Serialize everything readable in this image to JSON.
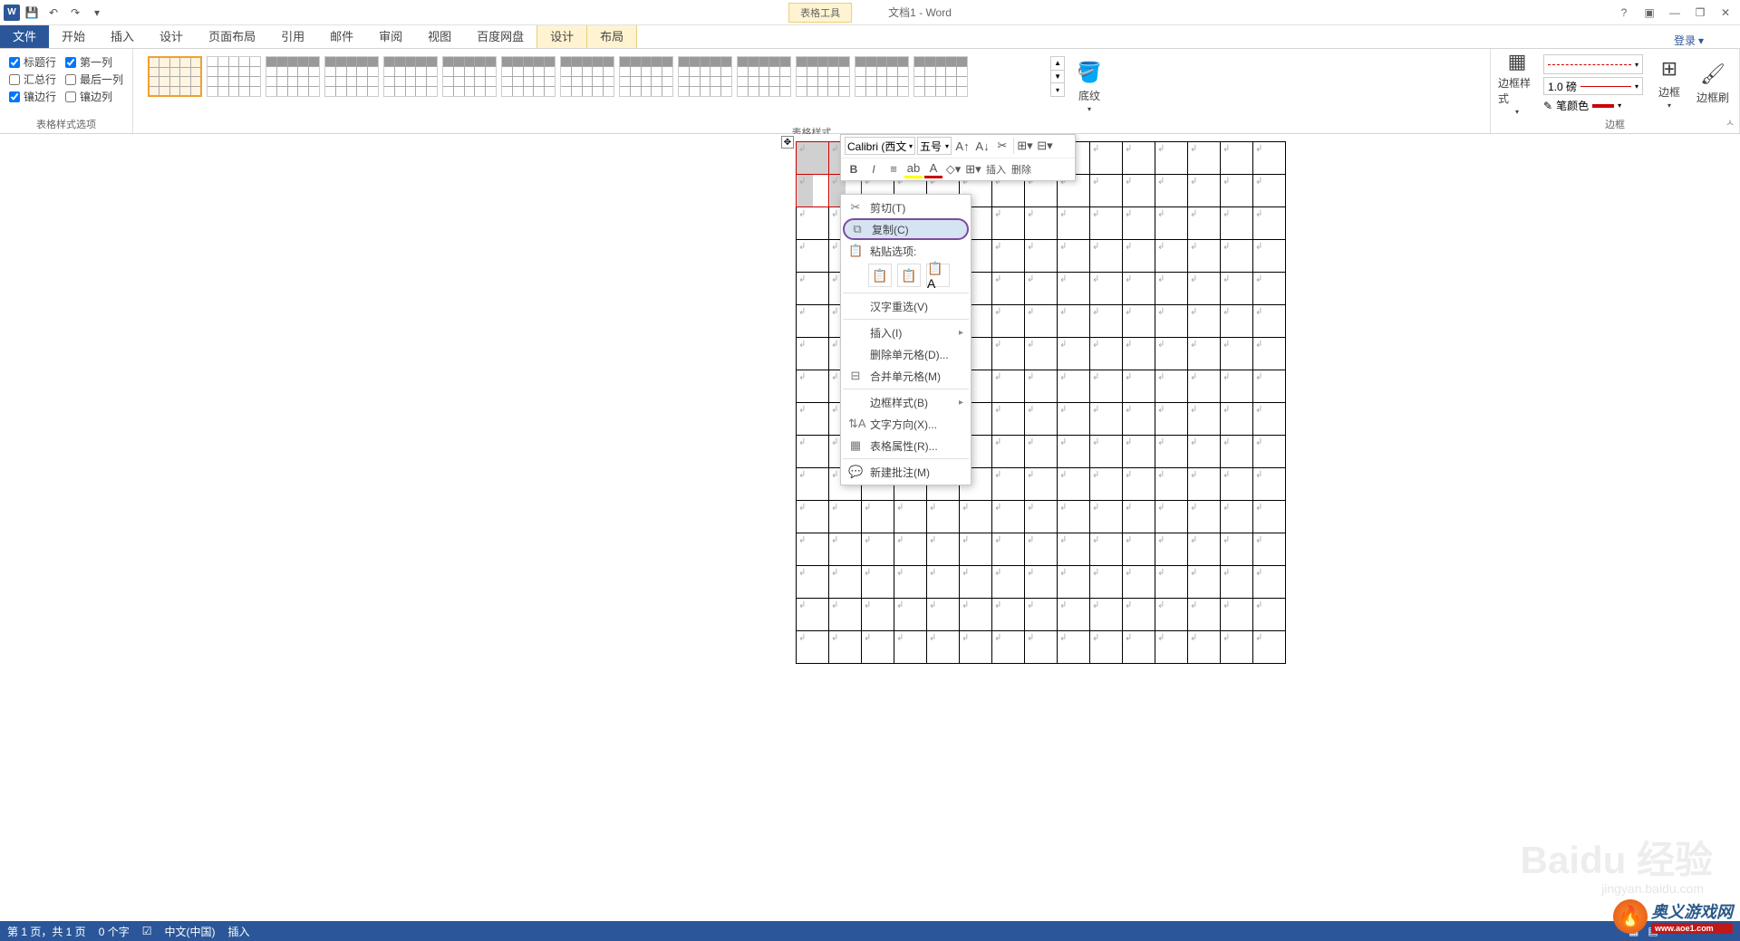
{
  "title": {
    "tools_context": "表格工具",
    "doc": "文档1 - Word"
  },
  "qat": {
    "save": "💾",
    "undo": "↶",
    "redo": "↷"
  },
  "win": {
    "help": "?",
    "ribbon_opts": "▣",
    "min": "—",
    "restore": "❐",
    "close": "✕"
  },
  "tabs": {
    "file": "文件",
    "home": "开始",
    "insert": "插入",
    "design": "设计",
    "layout": "页面布局",
    "refs": "引用",
    "mail": "邮件",
    "review": "审阅",
    "view": "视图",
    "baidu": "百度网盘",
    "tbl_design": "设计",
    "tbl_layout": "布局",
    "login": "登录"
  },
  "ribbon": {
    "style_opts": {
      "header_row": "标题行",
      "first_col": "第一列",
      "total_row": "汇总行",
      "last_col": "最后一列",
      "banded_row": "镶边行",
      "banded_col": "镶边列",
      "group": "表格样式选项"
    },
    "gallery": {
      "group": "表格样式"
    },
    "shading": "底纹",
    "border_styles": "边框样式",
    "line_weight": "1.0 磅",
    "pen_color": "笔颜色",
    "borders": "边框",
    "border_painter": "边框刷",
    "borders_group": "边框"
  },
  "mini": {
    "font": "Calibri (西文",
    "size": "五号",
    "insert": "插入",
    "delete": "删除"
  },
  "ctx": {
    "cut": "剪切(T)",
    "copy": "复制(C)",
    "paste_label": "粘贴选项:",
    "ime": "汉字重选(V)",
    "insert": "插入(I)",
    "del_cells": "删除单元格(D)...",
    "merge": "合并单元格(M)",
    "border_style": "边框样式(B)",
    "text_dir": "文字方向(X)...",
    "tbl_props": "表格属性(R)...",
    "new_comment": "新建批注(M)"
  },
  "status": {
    "page": "第 1 页，共 1 页",
    "words": "0 个字",
    "lang": "中文(中国)",
    "mode": "插入"
  },
  "watermark": {
    "main": "Baidu 经验",
    "sub": "jingyan.baidu.com"
  },
  "badge": {
    "main": "奥义游戏网",
    "sub": "www.aoe1.com"
  },
  "table": {
    "rows": 16,
    "cols": 15
  }
}
